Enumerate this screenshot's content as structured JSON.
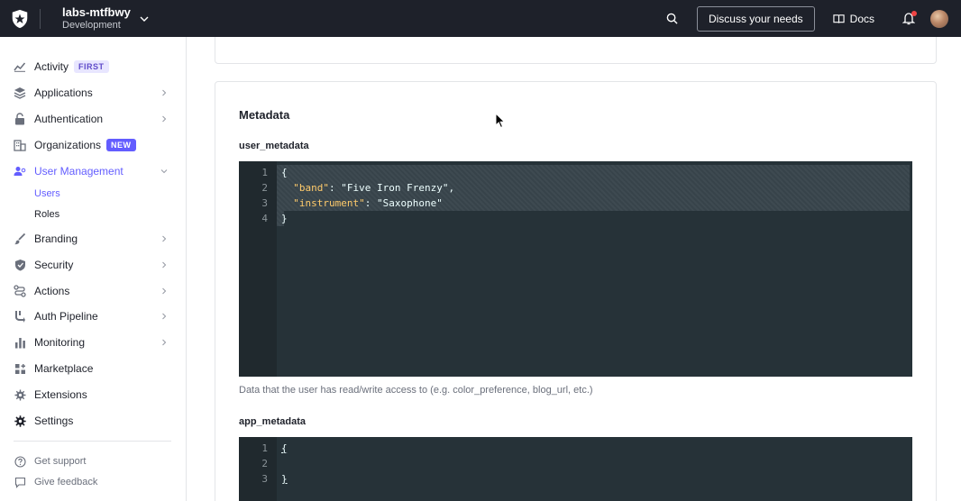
{
  "topbar": {
    "tenant_name": "labs-mtfbwy",
    "tenant_env": "Development",
    "discuss_label": "Discuss your needs",
    "docs_label": "Docs"
  },
  "sidebar": {
    "items": [
      {
        "label": "Activity",
        "badge": "FIRST"
      },
      {
        "label": "Applications"
      },
      {
        "label": "Authentication"
      },
      {
        "label": "Organizations",
        "badge": "NEW"
      },
      {
        "label": "User Management"
      },
      {
        "label": "Branding"
      },
      {
        "label": "Security"
      },
      {
        "label": "Actions"
      },
      {
        "label": "Auth Pipeline"
      },
      {
        "label": "Monitoring"
      },
      {
        "label": "Marketplace"
      },
      {
        "label": "Extensions"
      },
      {
        "label": "Settings"
      }
    ],
    "sub_items": [
      {
        "label": "Users"
      },
      {
        "label": "Roles"
      }
    ],
    "footer": [
      {
        "label": "Get support"
      },
      {
        "label": "Give feedback"
      }
    ]
  },
  "main": {
    "section_title": "Metadata",
    "user_metadata": {
      "label": "user_metadata",
      "lines": [
        {
          "num": "1",
          "code": "{"
        },
        {
          "num": "2",
          "key": "\"band\"",
          "value": ": \"Five Iron Frenzy\","
        },
        {
          "num": "3",
          "key": "\"instrument\"",
          "value": ": \"Saxophone\""
        },
        {
          "num": "4",
          "code": "}"
        }
      ],
      "help": "Data that the user has read/write access to (e.g. color_preference, blog_url, etc.)"
    },
    "app_metadata": {
      "label": "app_metadata",
      "lines": [
        {
          "num": "1",
          "code": "{"
        },
        {
          "num": "2",
          "code": ""
        },
        {
          "num": "3",
          "code": "}"
        }
      ]
    }
  },
  "colors": {
    "accent": "#635dff",
    "topbar": "#1e212a",
    "editor_bg": "#263238"
  }
}
